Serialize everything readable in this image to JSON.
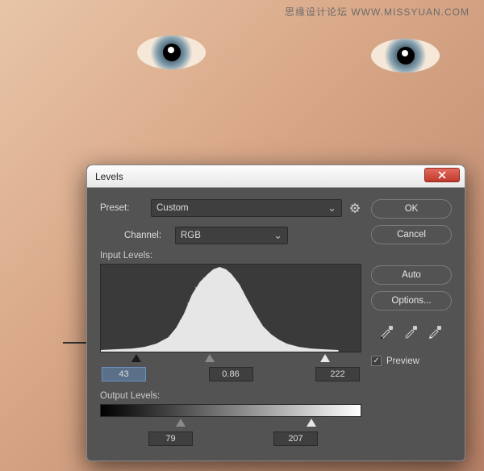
{
  "watermark": "思缘设计论坛 WWW.MISSYUAN.COM",
  "dialog": {
    "title": "Levels",
    "preset_label": "Preset:",
    "preset_value": "Custom",
    "channel_label": "Channel:",
    "channel_value": "RGB",
    "input_levels_label": "Input Levels:",
    "input_shadow": "43",
    "input_mid": "0.86",
    "input_highlight": "222",
    "output_levels_label": "Output Levels:",
    "output_shadow": "79",
    "output_highlight": "207",
    "ok": "OK",
    "cancel": "Cancel",
    "auto": "Auto",
    "options": "Options...",
    "preview_label": "Preview",
    "preview_checked": true
  }
}
